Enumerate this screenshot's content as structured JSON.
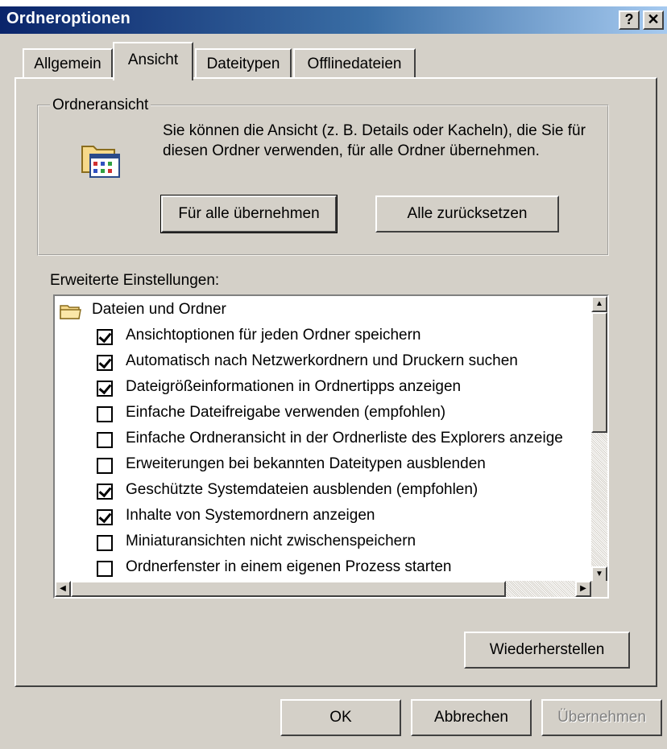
{
  "window": {
    "title": "Ordneroptionen",
    "help_button": "?",
    "close_button": "✕"
  },
  "tabs": [
    {
      "label": "Allgemein",
      "active": false
    },
    {
      "label": "Ansicht",
      "active": true
    },
    {
      "label": "Dateitypen",
      "active": false
    },
    {
      "label": "Offlinedateien",
      "active": false
    }
  ],
  "folder_view": {
    "group_title": "Ordneransicht",
    "description": "Sie können die Ansicht (z. B. Details oder Kacheln), die Sie für diesen Ordner verwenden, für alle Ordner übernehmen.",
    "apply_all_label": "Für alle übernehmen",
    "reset_all_label": "Alle zurücksetzen",
    "icon": "folder-options-icon"
  },
  "advanced": {
    "label": "Erweiterte Einstellungen:",
    "root_label": "Dateien und Ordner",
    "items": [
      {
        "label": "Ansichtoptionen für jeden Ordner speichern",
        "checked": true
      },
      {
        "label": "Automatisch nach Netzwerkordnern und Druckern suchen",
        "checked": true
      },
      {
        "label": "Dateigrößeinformationen in Ordnertipps anzeigen",
        "checked": true
      },
      {
        "label": "Einfache Dateifreigabe verwenden (empfohlen)",
        "checked": false
      },
      {
        "label": "Einfache Ordneransicht in der Ordnerliste des Explorers anzeige",
        "checked": false
      },
      {
        "label": "Erweiterungen bei bekannten Dateitypen ausblenden",
        "checked": false
      },
      {
        "label": "Geschützte Systemdateien ausblenden (empfohlen)",
        "checked": true
      },
      {
        "label": "Inhalte von Systemordnern anzeigen",
        "checked": true
      },
      {
        "label": "Miniaturansichten nicht zwischenspeichern",
        "checked": false
      },
      {
        "label": "Ordnerfenster in einem eigenen Prozess starten",
        "checked": false
      }
    ],
    "restore_label": "Wiederherstellen"
  },
  "footer": {
    "ok_label": "OK",
    "cancel_label": "Abbrechen",
    "apply_label": "Übernehmen"
  }
}
